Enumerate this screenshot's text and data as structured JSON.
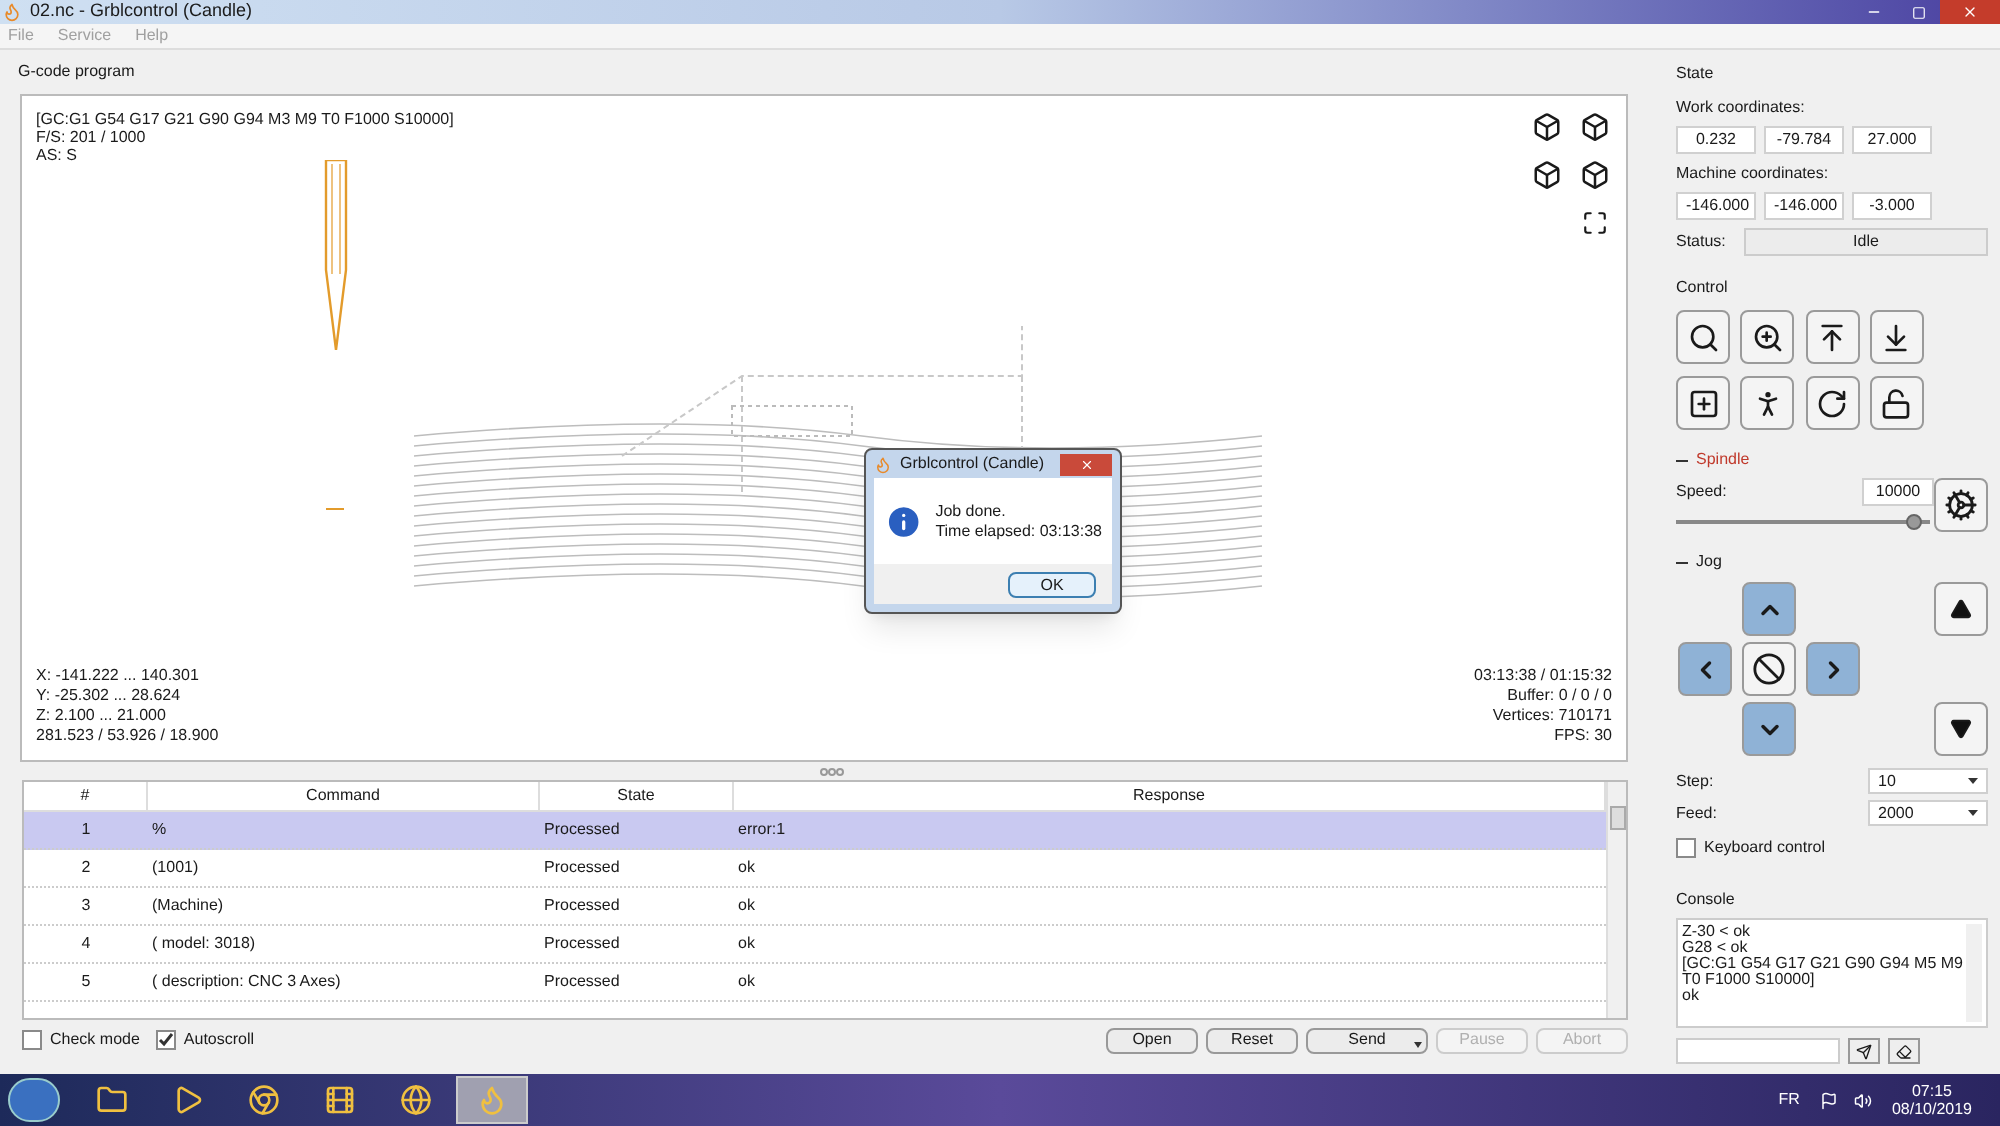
{
  "window": {
    "title": "02.nc - Grblcontrol  (Candle)"
  },
  "menu": [
    "File",
    "Service",
    "Help"
  ],
  "viewer": {
    "title": "G-code program",
    "status_lines": [
      "[GC:G1 G54 G17 G21 G90 G94 M3 M9 T0 F1000 S10000]",
      "F/S: 201 / 1000",
      "AS: S"
    ],
    "bounds_lines": [
      "X: -141.222 ... 140.301",
      "Y: -25.302 ... 28.624",
      "Z: 2.100 ... 21.000",
      "281.523 / 53.926 / 18.900"
    ],
    "stats_lines": [
      "03:13:38 / 01:15:32",
      "Buffer: 0 / 0 / 0",
      "Vertices: 710171",
      "FPS: 30"
    ]
  },
  "table": {
    "columns": [
      "#",
      "Command",
      "State",
      "Response"
    ],
    "rows": [
      {
        "cells": [
          "1",
          "%",
          "Processed",
          "error:1"
        ],
        "selected": true
      },
      {
        "cells": [
          "2",
          "(1001)",
          "Processed",
          "ok"
        ],
        "selected": false
      },
      {
        "cells": [
          "3",
          "(Machine)",
          "Processed",
          "ok"
        ],
        "selected": false
      },
      {
        "cells": [
          "4",
          "(  model: 3018)",
          "Processed",
          "ok"
        ],
        "selected": false
      },
      {
        "cells": [
          "5",
          "(  description: CNC 3 Axes)",
          "Processed",
          "ok"
        ],
        "selected": false
      }
    ]
  },
  "options": [
    {
      "label": "Check mode",
      "checked": false
    },
    {
      "label": "Autoscroll",
      "checked": true
    }
  ],
  "buttons": [
    {
      "label": "Open",
      "disabled": false,
      "kind": "plain"
    },
    {
      "label": "Reset",
      "disabled": false,
      "kind": "plain"
    },
    {
      "label": "Send",
      "disabled": false,
      "kind": "menu"
    },
    {
      "label": "Pause",
      "disabled": true,
      "kind": "plain"
    },
    {
      "label": "Abort",
      "disabled": true,
      "kind": "plain"
    }
  ],
  "state": {
    "title": "State",
    "work_label": "Work coordinates:",
    "work": [
      "0.232",
      "-79.784",
      "27.000"
    ],
    "machine_label": "Machine coordinates:",
    "machine": [
      "-146.000",
      "-146.000",
      "-3.000"
    ],
    "status_label": "Status:",
    "status": "Idle"
  },
  "control": {
    "title": "Control"
  },
  "spindle": {
    "title": "Spindle",
    "speed_label": "Speed:",
    "speed": "10000",
    "level": 0.97
  },
  "jog": {
    "title": "Jog",
    "step_label": "Step:",
    "step": "10",
    "feed_label": "Feed:",
    "feed": "2000",
    "keyboard": {
      "label": "Keyboard control",
      "checked": false
    }
  },
  "console": {
    "title": "Console",
    "lines": [
      "Z-30 < ok",
      "G28 < ok",
      "[GC:G1 G54 G17 G21 G90 G94 M5 M9 T0 F1000 S10000]",
      "ok"
    ]
  },
  "dialog": {
    "title": "Grblcontrol  (Candle)",
    "lines": [
      "Job done.",
      "Time elapsed: 03:13:38"
    ],
    "ok": "OK"
  },
  "taskbar": {
    "apps": [
      {
        "selected": false
      },
      {
        "selected": false
      },
      {
        "selected": false
      },
      {
        "selected": false
      },
      {
        "selected": false
      },
      {
        "selected": true
      }
    ],
    "lang": "FR",
    "time": "07:15",
    "date": "08/10/2019"
  }
}
